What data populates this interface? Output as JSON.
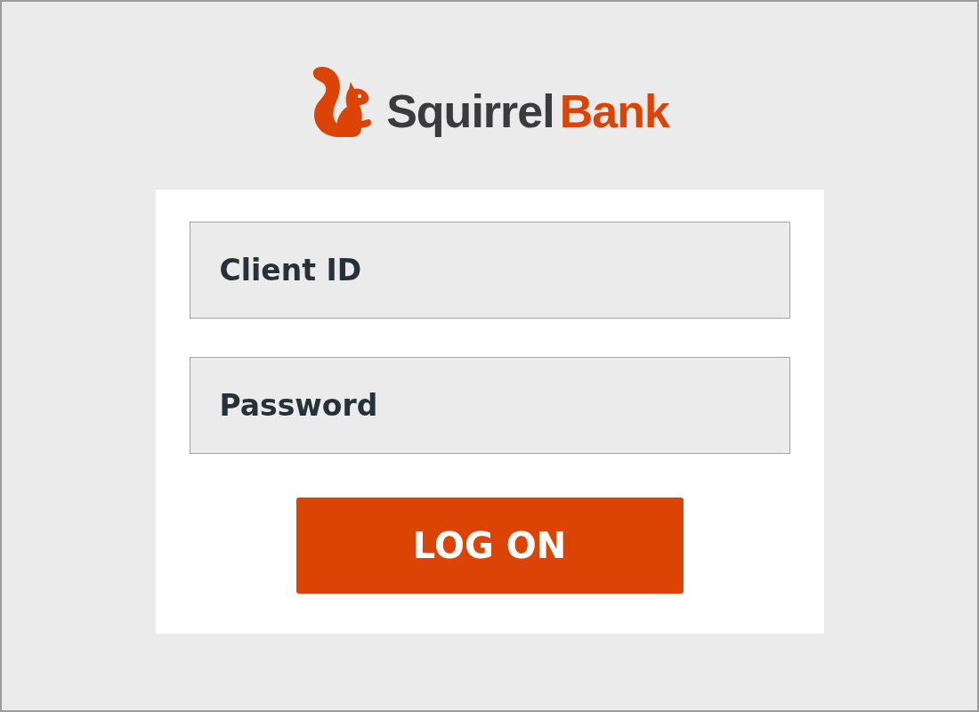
{
  "logo": {
    "name_dark": "Squirrel",
    "name_accent": "Bank"
  },
  "fields": [
    {
      "placeholder": "Client ID"
    },
    {
      "placeholder": "Password"
    }
  ],
  "button": "LOG ON"
}
